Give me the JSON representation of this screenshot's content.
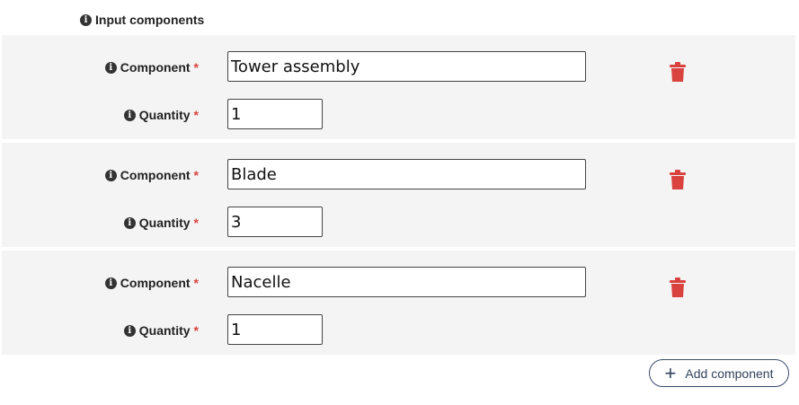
{
  "section": {
    "title": "Input components",
    "icon": "info-icon"
  },
  "labels": {
    "component": "Component",
    "quantity": "Quantity",
    "required_marker": "*",
    "info_glyph": "i"
  },
  "rows": [
    {
      "component": "Tower assembly",
      "quantity": "1"
    },
    {
      "component": "Blade",
      "quantity": "3"
    },
    {
      "component": "Nacelle",
      "quantity": "1"
    }
  ],
  "actions": {
    "add_label": "Add component",
    "add_icon": "plus-icon",
    "delete_icon": "trash-icon"
  },
  "colors": {
    "row_background": "#f4f4f4",
    "required": "#d9423e",
    "delete": "#d9423e",
    "add_button_border": "#3b4a6b"
  }
}
